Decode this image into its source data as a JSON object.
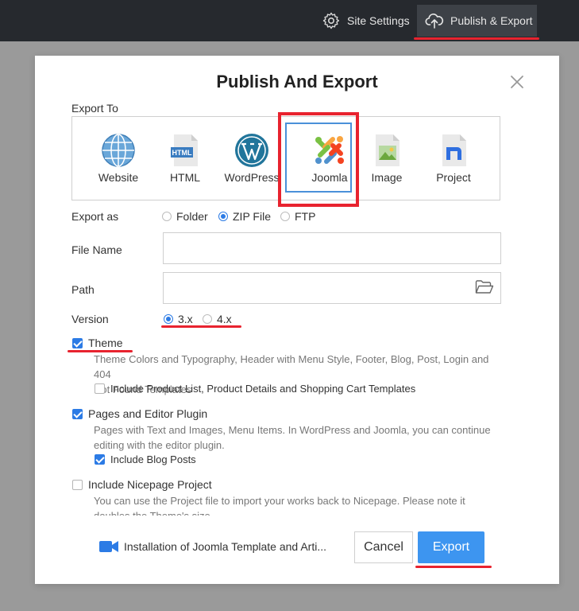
{
  "topbar": {
    "site_settings_label": "Site Settings",
    "publish_export_label": "Publish & Export"
  },
  "dialog": {
    "title": "Publish And Export",
    "export_to_label": "Export To",
    "targets": [
      {
        "label": "Website",
        "icon": "globe-icon"
      },
      {
        "label": "HTML",
        "icon": "html-file-icon"
      },
      {
        "label": "WordPress",
        "icon": "wordpress-icon"
      },
      {
        "label": "Joomla",
        "icon": "joomla-icon",
        "selected": true
      },
      {
        "label": "Image",
        "icon": "image-file-icon"
      },
      {
        "label": "Project",
        "icon": "nicepage-project-icon"
      }
    ],
    "export_as": {
      "label": "Export as",
      "options": [
        "Folder",
        "ZIP File",
        "FTP"
      ],
      "selected": "ZIP File"
    },
    "file_name": {
      "label": "File Name",
      "value": ""
    },
    "path": {
      "label": "Path",
      "value": ""
    },
    "version": {
      "label": "Version",
      "options": [
        "3.x",
        "4.x"
      ],
      "selected": "3.x"
    },
    "theme": {
      "label": "Theme",
      "checked": true,
      "description_line1": "Theme Colors and Typography, Header with Menu Style, Footer, Blog, Post, Login and 404",
      "description_line2": "Not Found Templates",
      "sub_option": {
        "label": "Include Product List, Product Details and Shopping Cart Templates",
        "checked": false
      }
    },
    "pages": {
      "label": "Pages and Editor Plugin",
      "checked": true,
      "description_line1": "Pages with Text and Images, Menu Items. In WordPress and Joomla, you can continue",
      "description_line2": "editing with the editor plugin.",
      "sub_option": {
        "label": "Include Blog Posts",
        "checked": true
      }
    },
    "nicepage_project": {
      "label": "Include Nicepage Project",
      "checked": false,
      "description_line1": "You can use the Project file to import your works back to Nicepage. Please note it",
      "description_line2": "doubles the Theme's size."
    },
    "footer": {
      "installation_link": "Installation of Joomla Template and Arti...",
      "cancel_label": "Cancel",
      "export_label": "Export"
    }
  },
  "colors": {
    "accent": "#3d95f0",
    "annotation_red": "#e8232f",
    "topbar_bg": "#26292e"
  }
}
